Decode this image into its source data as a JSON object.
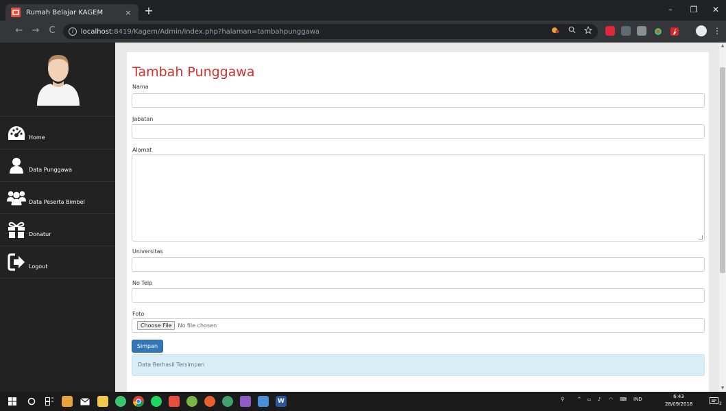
{
  "browser": {
    "tab_title": "Rumah Belajar KAGEM",
    "tab_close": "×",
    "new_tab": "+",
    "url_host": "localhost",
    "url_path": ":8419/Kagem/Admin/index.php?halaman=tambahpunggawa",
    "back": "←",
    "forward": "→",
    "reload": "C",
    "minimize": "–",
    "maximize": "❐",
    "close": "✕"
  },
  "sidebar": {
    "items": [
      {
        "label": "Home",
        "icon": "dashboard-icon"
      },
      {
        "label": "Data Punggawa",
        "icon": "user-icon"
      },
      {
        "label": "Data Peserta Bimbel",
        "icon": "users-group-icon"
      },
      {
        "label": "Donatur",
        "icon": "gift-icon"
      },
      {
        "label": "Logout",
        "icon": "sign-out-icon"
      }
    ]
  },
  "form": {
    "title": "Tambah Punggawa",
    "nama_label": "Nama",
    "jabatan_label": "Jabatan",
    "alamat_label": "Alamat",
    "universitas_label": "Universitas",
    "notelp_label": "No Telp",
    "foto_label": "Foto",
    "choose_file": "Choose File",
    "no_file": "No file chosen",
    "submit": "Simpan",
    "alert": "Data Berhasil Tersimpan"
  },
  "taskbar": {
    "lang": "IND",
    "time": "6:43",
    "date": "28/09/2018",
    "notification_count": "2"
  },
  "colors": {
    "title_red": "#d9302a",
    "button_blue": "#3278b6",
    "alert_bg": "#d9edf7",
    "sidebar_bg": "#222222"
  }
}
